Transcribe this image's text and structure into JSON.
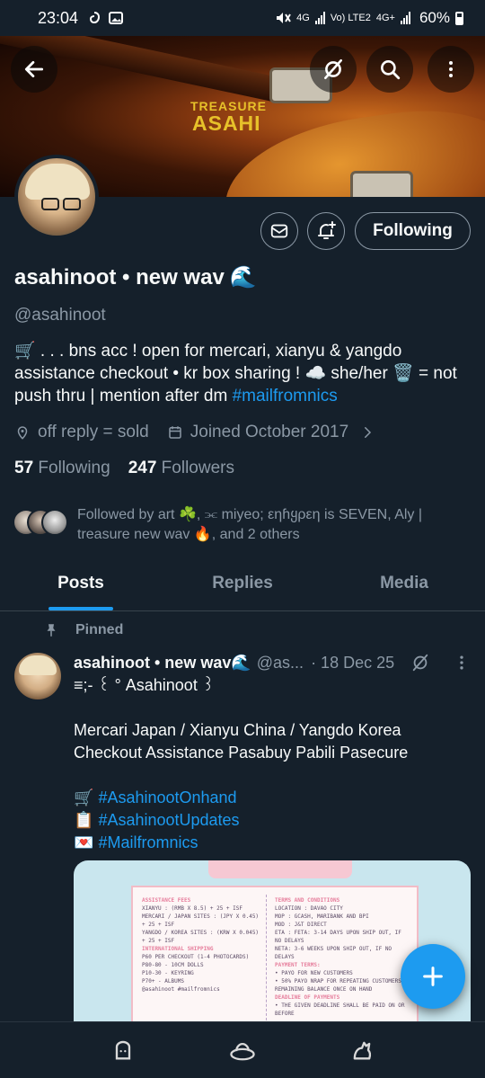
{
  "status_bar": {
    "time": "23:04",
    "network_1": "4G",
    "network_2": "Vo) LTE2",
    "network_3": "4G+",
    "battery": "60%"
  },
  "banner": {
    "line1": "TREASURE",
    "line2": "ASAHI"
  },
  "profile": {
    "display_name": "asahinoot • new wav",
    "name_emoji": "🌊",
    "handle": "@asahinoot",
    "bio_text": "🛒 . . . bns acc ! open for mercari, xianyu & yangdo assistance checkout • kr box sharing ! ☁️ she/her 🗑️ = not push thru | mention after dm ",
    "bio_hashtag": "#mailfromnics",
    "location": "off reply = sold",
    "joined": "Joined October 2017",
    "following_count": "57",
    "following_label": "Following",
    "followers_count": "247",
    "followers_label": "Followers",
    "followed_by": "Followed by art ☘️, ⫘ miyeo; εηɦყρεη is SEVEN, Aly | treasure new wav 🔥, and 2 others",
    "follow_button": "Following"
  },
  "tabs": [
    {
      "label": "Posts",
      "active": true
    },
    {
      "label": "Replies",
      "active": false
    },
    {
      "label": "Media",
      "active": false
    }
  ],
  "pinned_tweet": {
    "pinned_label": "Pinned",
    "author_name": "asahinoot • new wav",
    "author_emoji": "🌊",
    "author_handle": "@as...",
    "date": "· 18 Dec 25",
    "line1": "≡;- ꒰ ° Asahinoot ꒱",
    "line2": "",
    "line3": "Mercari Japan / Xianyu China / Yangdo Korea Checkout Assistance Pasabuy Pabili Pasecure",
    "line4": "",
    "tag1_emoji": "🛒",
    "tag1": "#AsahinootOnhand",
    "tag2_emoji": "📋",
    "tag2": "#AsahinootUpdates",
    "tag3_emoji": "💌",
    "tag3": "#Mailfromnics"
  },
  "media": {
    "left_title": "ASSISTANCE FEES",
    "left_lines": [
      "XIANYU : (RMB X 8.5) + 25 + ISF",
      "MERCARI / JAPAN SITES : (JPY X 0.45) + 25 + ISF",
      "YANGDO / KOREA SITES : (KRW X 0.045) + 25 + ISF",
      "",
      "INTERNATIONAL SHIPPING",
      "P60 PER CHECKOUT (1-4 PHOTOCARDS)",
      "P80-80 - 10CM DOLLS",
      "P10-30 - KEYRING",
      "P70+ - ALBUMS",
      "",
      "@asahinoot #mailfromnics"
    ],
    "right_title": "TERMS AND CONDITIONS",
    "right_lines": [
      "LOCATION : DAVAO CITY",
      "MOP : GCASH, MARIBANK AND BPI",
      "MOD : J&T DIRECT",
      "ETA : FETA: 3-14 DAYS UPON SHIP OUT, IF NO DELAYS",
      "NETA: 3-6 WEEKS UPON SHIP OUT, IF NO DELAYS",
      "PAYMENT TERMS:",
      "• PAYO FOR NEW CUSTOMERS",
      "• 50% PAYO NRAP FOR REPEATING CUSTOMERS; REMAINING BALANCE ONCE ON HAND",
      "DEADLINE OF PAYMENTS",
      "• THE GIVEN DEADLINE SHALL BE PAID ON OR BEFORE"
    ]
  },
  "colors": {
    "background": "#15202b",
    "accent": "#1d9bf0",
    "muted": "#8b98a5"
  }
}
